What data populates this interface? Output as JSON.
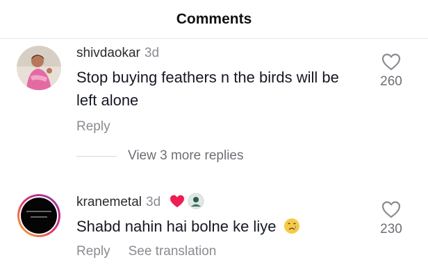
{
  "header": {
    "title": "Comments"
  },
  "comments": [
    {
      "username": "shivdaokar",
      "age": "3d",
      "text": "Stop buying feathers n the birds will be left alone",
      "reply_label": "Reply",
      "likes": "260",
      "avatar_icon": "user-photo-avatar"
    },
    {
      "username": "kranemetal",
      "age": "3d",
      "text": "Shabd nahin hai bolne ke liye",
      "reply_label": "Reply",
      "translate_label": "See translation",
      "likes": "230",
      "badges": [
        "red-heart-icon",
        "creator-avatar-icon"
      ],
      "emoji": "crying-face-emoji",
      "avatar_icon": "story-ring-avatar"
    }
  ],
  "view_more": {
    "label": "View 3 more replies"
  }
}
